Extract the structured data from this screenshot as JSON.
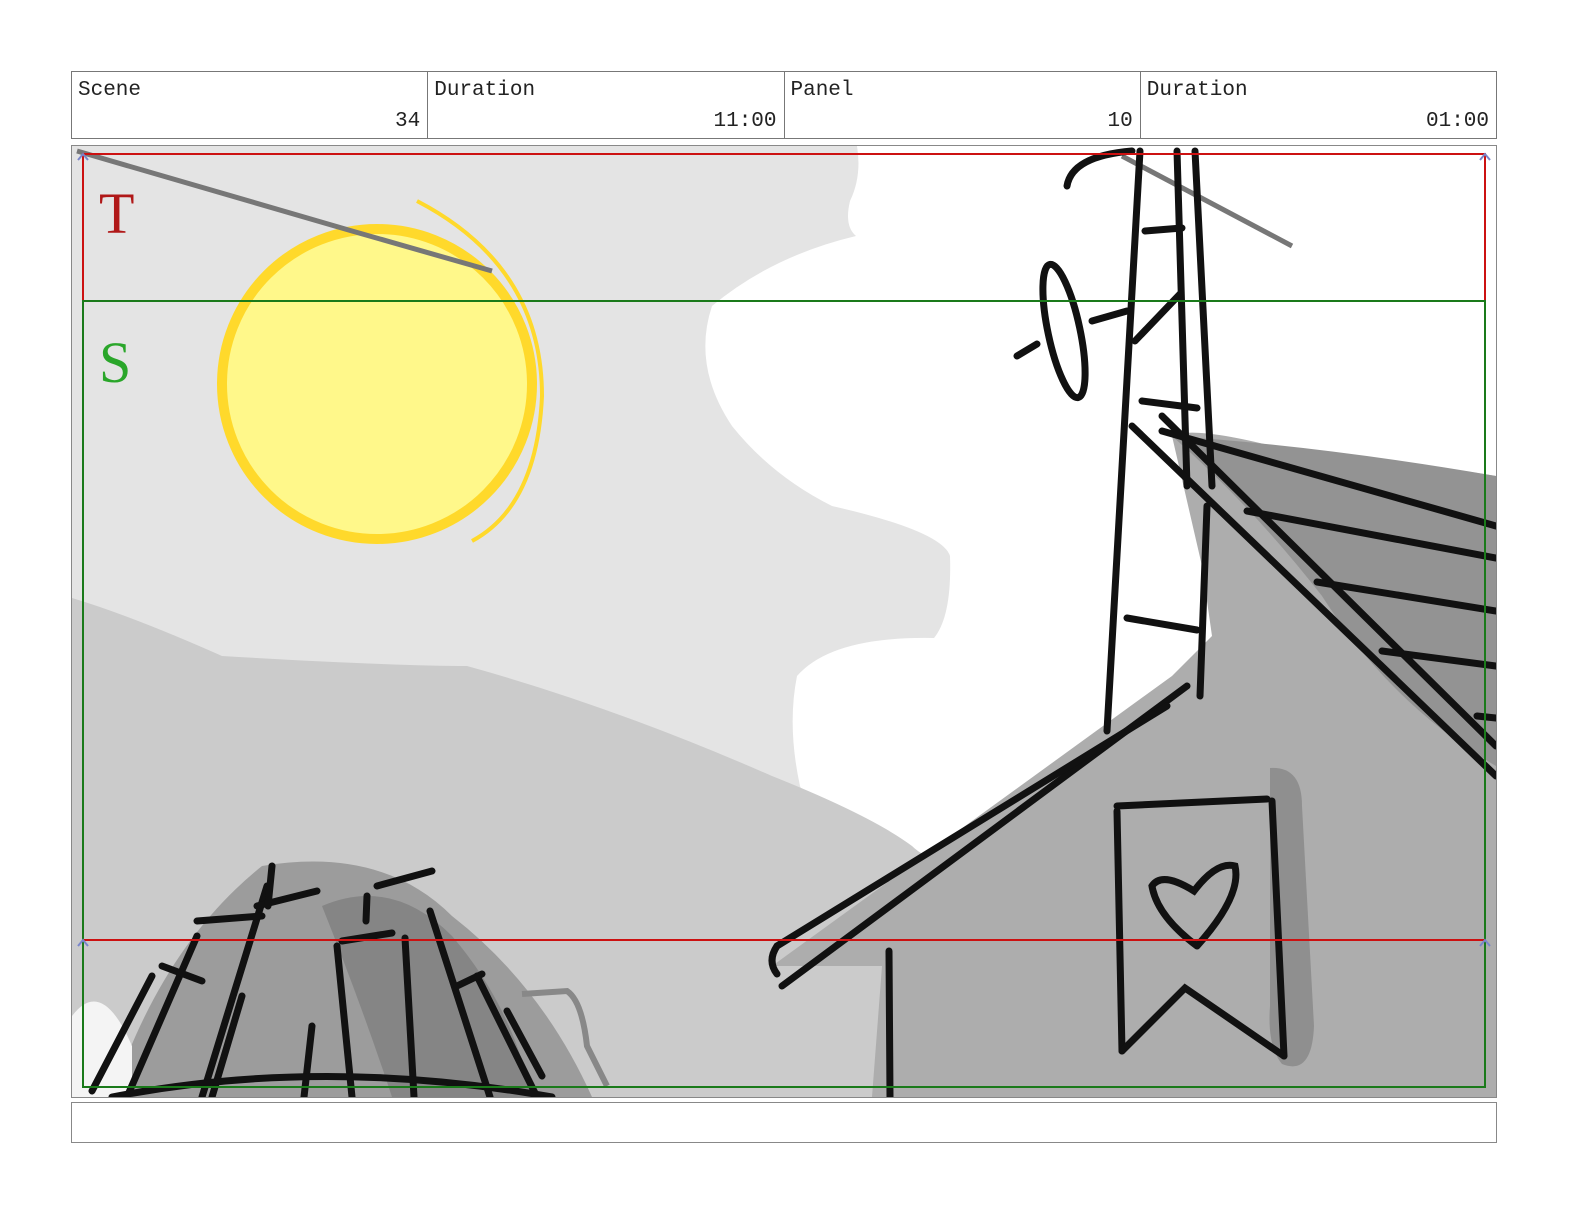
{
  "header": {
    "scene_label": "Scene",
    "scene_value": "34",
    "scene_duration_label": "Duration",
    "scene_duration_value": "11:00",
    "panel_label": "Panel",
    "panel_value": "10",
    "panel_duration_label": "Duration",
    "panel_duration_value": "01:00"
  },
  "guides": {
    "title_safe_letter": "T",
    "action_safe_letter": "S",
    "title_safe_color": "#cc1111",
    "action_safe_color": "#22aa22"
  },
  "notes": {
    "text": ""
  }
}
